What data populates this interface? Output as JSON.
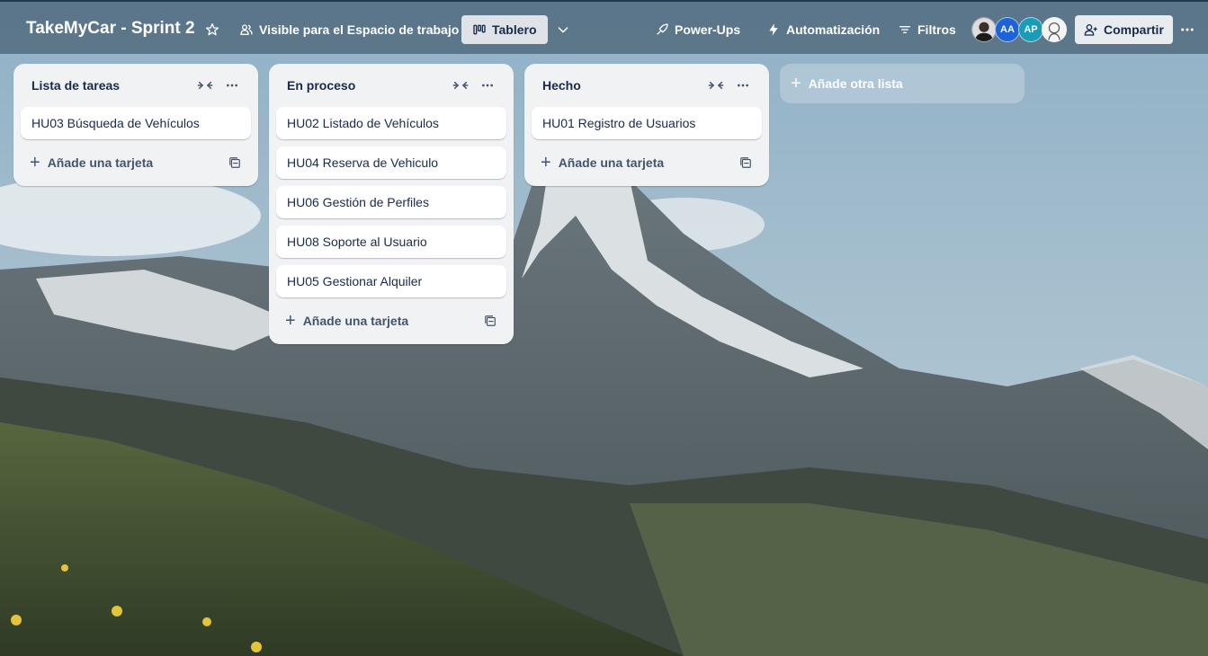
{
  "board": {
    "title": "TakeMyCar - Sprint 2"
  },
  "header": {
    "visibility_label": "Visible para el Espacio de trabajo",
    "view_label": "Tablero",
    "powerups_label": "Power-Ups",
    "automation_label": "Automatización",
    "filters_label": "Filtros",
    "share_label": "Compartir",
    "avatars": [
      {
        "initials": "",
        "color": "#2b2b2b"
      },
      {
        "initials": "AA",
        "color": "#1f62d6"
      },
      {
        "initials": "AP",
        "color": "#1a9bb8"
      },
      {
        "initials": "",
        "color": "#f2f2f2"
      }
    ]
  },
  "lists": [
    {
      "title": "Lista de tareas",
      "cards": [
        "HU03 Búsqueda de Vehículos"
      ],
      "add_card_label": "Añade una tarjeta"
    },
    {
      "title": "En proceso",
      "cards": [
        "HU02 Listado de Vehículos",
        "HU04 Reserva de Vehiculo",
        "HU06 Gestión de Perfiles",
        "HU08 Soporte al Usuario",
        "HU05 Gestionar Alquiler"
      ],
      "add_card_label": "Añade una tarjeta"
    },
    {
      "title": "Hecho",
      "cards": [
        "HU01 Registro de Usuarios"
      ],
      "add_card_label": "Añade una tarjeta"
    }
  ],
  "add_list_label": "Añade otra lista",
  "icons": {
    "star": "star-icon",
    "visibility": "people-icon",
    "view": "board-icon",
    "chevron": "chevron-down-icon",
    "powerups": "rocket-icon",
    "automation": "lightning-icon",
    "filters": "filter-icon",
    "share": "add-person-icon",
    "more": "ellipsis-icon",
    "collapse": "collapse-icon",
    "template": "card-template-icon"
  },
  "colors": {
    "header_bg": "#466073",
    "list_bg": "#f1f2f4",
    "card_text": "#172b4d",
    "view_button_bg": "#dfe3e8"
  }
}
